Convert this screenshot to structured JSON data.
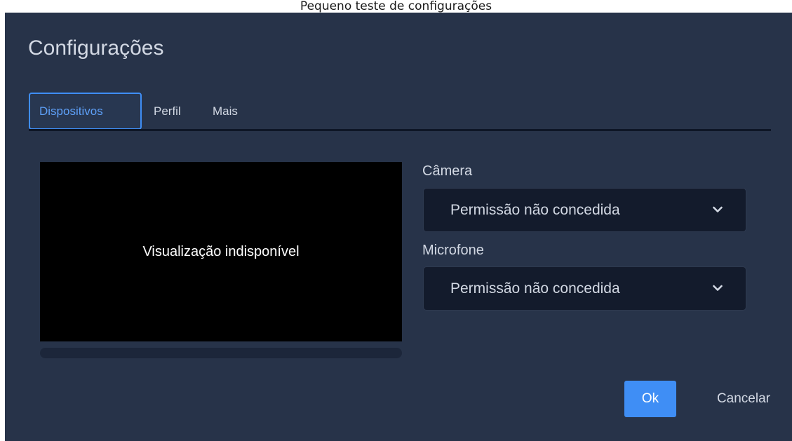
{
  "window": {
    "title": "Pequeno teste de configurações"
  },
  "dialog": {
    "title": "Configurações",
    "tabs": [
      {
        "label": "Dispositivos",
        "active": true
      },
      {
        "label": "Perfil",
        "active": false
      },
      {
        "label": "Mais",
        "active": false
      }
    ],
    "preview": {
      "message": "Visualização indisponível"
    },
    "camera": {
      "label": "Câmera",
      "selected": "Permissão não concedida",
      "icon": "chevron-down-icon"
    },
    "microphone": {
      "label": "Microfone",
      "selected": "Permissão não concedida",
      "icon": "chevron-down-icon"
    },
    "buttons": {
      "ok": "Ok",
      "cancel": "Cancelar"
    }
  },
  "colors": {
    "background": "#273349",
    "accent": "#3f8ef5",
    "text": "#d2d8e3",
    "select_bg": "#131b2c"
  }
}
